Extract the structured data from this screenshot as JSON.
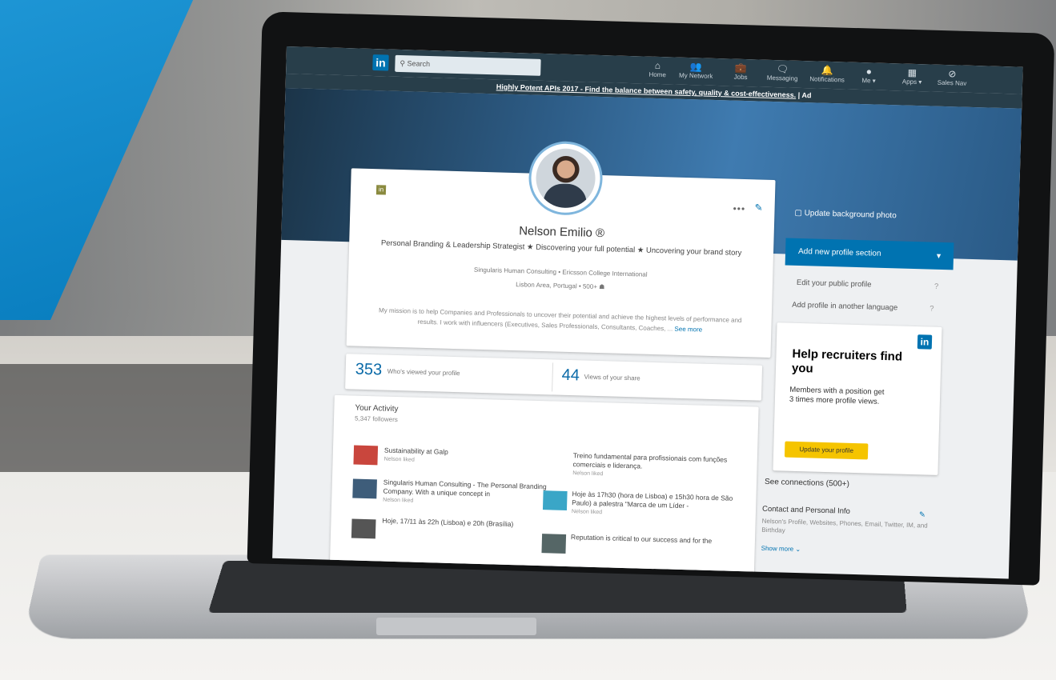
{
  "nav": {
    "logo": "in",
    "search_placeholder": "Search",
    "items": [
      {
        "label": "Home",
        "icon": "home-icon",
        "glyph": "⌂"
      },
      {
        "label": "My Network",
        "icon": "network-icon",
        "glyph": "👥"
      },
      {
        "label": "Jobs",
        "icon": "briefcase-icon",
        "glyph": "💼"
      },
      {
        "label": "Messaging",
        "icon": "messaging-icon",
        "glyph": "🗨"
      },
      {
        "label": "Notifications",
        "icon": "bell-icon",
        "glyph": "🔔"
      },
      {
        "label": "Me ▾",
        "icon": "avatar-icon",
        "glyph": "●"
      },
      {
        "label": "Apps ▾",
        "icon": "grid-icon",
        "glyph": "▦"
      },
      {
        "label": "Sales Nav",
        "icon": "compass-icon",
        "glyph": "⊘"
      }
    ]
  },
  "ad": {
    "text": "Highly Potent APIs 2017 - Find the balance between safety, quality & cost-effectiveness.",
    "suffix": " | Ad"
  },
  "profile": {
    "badge": "in",
    "more": "•••",
    "name": "Nelson Emilio ®",
    "headline": "Personal Branding & Leadership Strategist ★ Discovering your full potential ★ Uncovering your brand story",
    "company": "Singularis Human Consulting • Ericsson College International",
    "location": "Lisbon Area, Portugal • 500+ ☗",
    "summary": "My mission is to help Companies and Professionals to uncover their potential and achieve the highest levels of performance and results. I work with influencers (Executives, Sales Professionals, Consultants, Coaches, ...",
    "see_more": "See more"
  },
  "stats": {
    "views_profile_count": "353",
    "views_profile_label": "Who's viewed your profile",
    "views_share_count": "44",
    "views_share_label": "Views of your share"
  },
  "activity": {
    "title": "Your Activity",
    "followers": "5,347 followers",
    "left": [
      {
        "title": "Sustainability at Galp",
        "meta": "Nelson liked"
      },
      {
        "title": "Singularis Human Consulting - The Personal Branding Company. With a unique concept in",
        "meta": "Nelson liked"
      },
      {
        "title": "Hoje, 17/11 às 22h (Lisboa) e 20h (Brasília)",
        "meta": ""
      }
    ],
    "right": [
      {
        "title": "Treino fundamental para profissionais com funções comerciais e liderança.",
        "meta": "Nelson liked"
      },
      {
        "title": "Hoje às 17h30 (hora de Lisboa) e 15h30 hora de São Paulo) a palestra \"Marca de um Líder -",
        "meta": "Nelson liked"
      },
      {
        "title": "Reputation is critical to our success and for the",
        "meta": ""
      }
    ]
  },
  "sidebar": {
    "update_bg": "Update background photo",
    "add_section": "Add new profile section",
    "edit_public": "Edit your public profile",
    "add_language": "Add profile in another language",
    "help_icon": "?",
    "see_connections": "See connections (500+)",
    "contact_title": "Contact and Personal Info",
    "contact_text": "Nelson's Profile, Websites, Phones, Email, Twitter, IM, and Birthday",
    "show_more": "Show more ⌄"
  },
  "recruit": {
    "logo": "in",
    "title": "Help recruiters find you",
    "text": "Members with a position get 3 times more profile views.",
    "button": "Update your profile"
  }
}
